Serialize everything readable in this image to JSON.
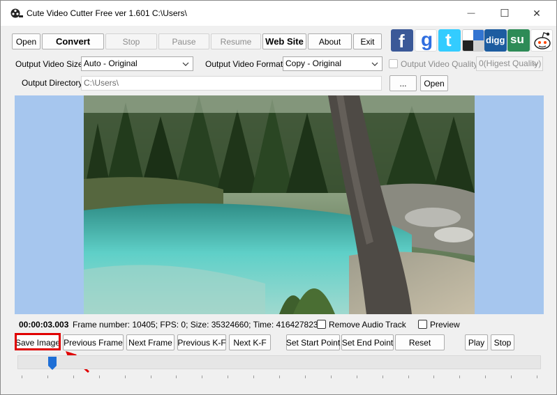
{
  "window": {
    "title": "Cute Video Cutter Free ver 1.601  C:\\Users\\",
    "minimize_glyph": "—",
    "maximize_glyph": "☐",
    "close_glyph": "✕"
  },
  "toolbar": {
    "open": "Open",
    "convert": "Convert",
    "stop": "Stop",
    "pause": "Pause",
    "resume": "Resume",
    "website": "Web Site",
    "about": "About",
    "exit": "Exit"
  },
  "social": [
    {
      "name": "facebook",
      "glyph": "f",
      "color": "#3b5998"
    },
    {
      "name": "google",
      "glyph": "g",
      "color": "#d93025"
    },
    {
      "name": "twitter",
      "glyph": "t",
      "color": "#33ccff"
    },
    {
      "name": "delicious",
      "glyph": "",
      "color": "#3274d1"
    },
    {
      "name": "digg",
      "glyph": "digg",
      "color": "#1d5ca0"
    },
    {
      "name": "stumbleupon",
      "glyph": "su",
      "color": "#2e8b57"
    },
    {
      "name": "reddit",
      "glyph": "",
      "color": "#ff4500"
    }
  ],
  "settings": {
    "video_size_label": "Output Video Size:",
    "video_size_value": "Auto - Original",
    "video_format_label": "Output Video Format:",
    "video_format_value": "Copy - Original",
    "video_quality_label": "Output Video Quality",
    "video_quality_value": "0(Higest Quality)",
    "output_dir_label": "Output Directory:",
    "output_dir_value": "C:\\Users\\",
    "browse": "...",
    "open_dir": "Open"
  },
  "status": {
    "timecode": "00:00:03.003",
    "info": "Frame number: 10405; FPS: 0; Size: 35324660; Time: 416427823",
    "remove_audio": "Remove Audio Track",
    "preview": "Preview"
  },
  "controls": {
    "save_image": "Save Image",
    "previous_frame": "Previous Frame",
    "next_frame": "Next Frame",
    "previous_kf": "Previous K-F",
    "next_kf": "Next K-F",
    "set_start": "Set  Start Point",
    "set_end": "Set  End Point",
    "reset": "Reset",
    "play": "Play",
    "stop": "Stop"
  },
  "slider": {
    "position_fraction": 0.06
  },
  "colors": {
    "video_background": "#a6c6ee",
    "highlight": "#e00000",
    "thumb": "#1f6fd6"
  }
}
